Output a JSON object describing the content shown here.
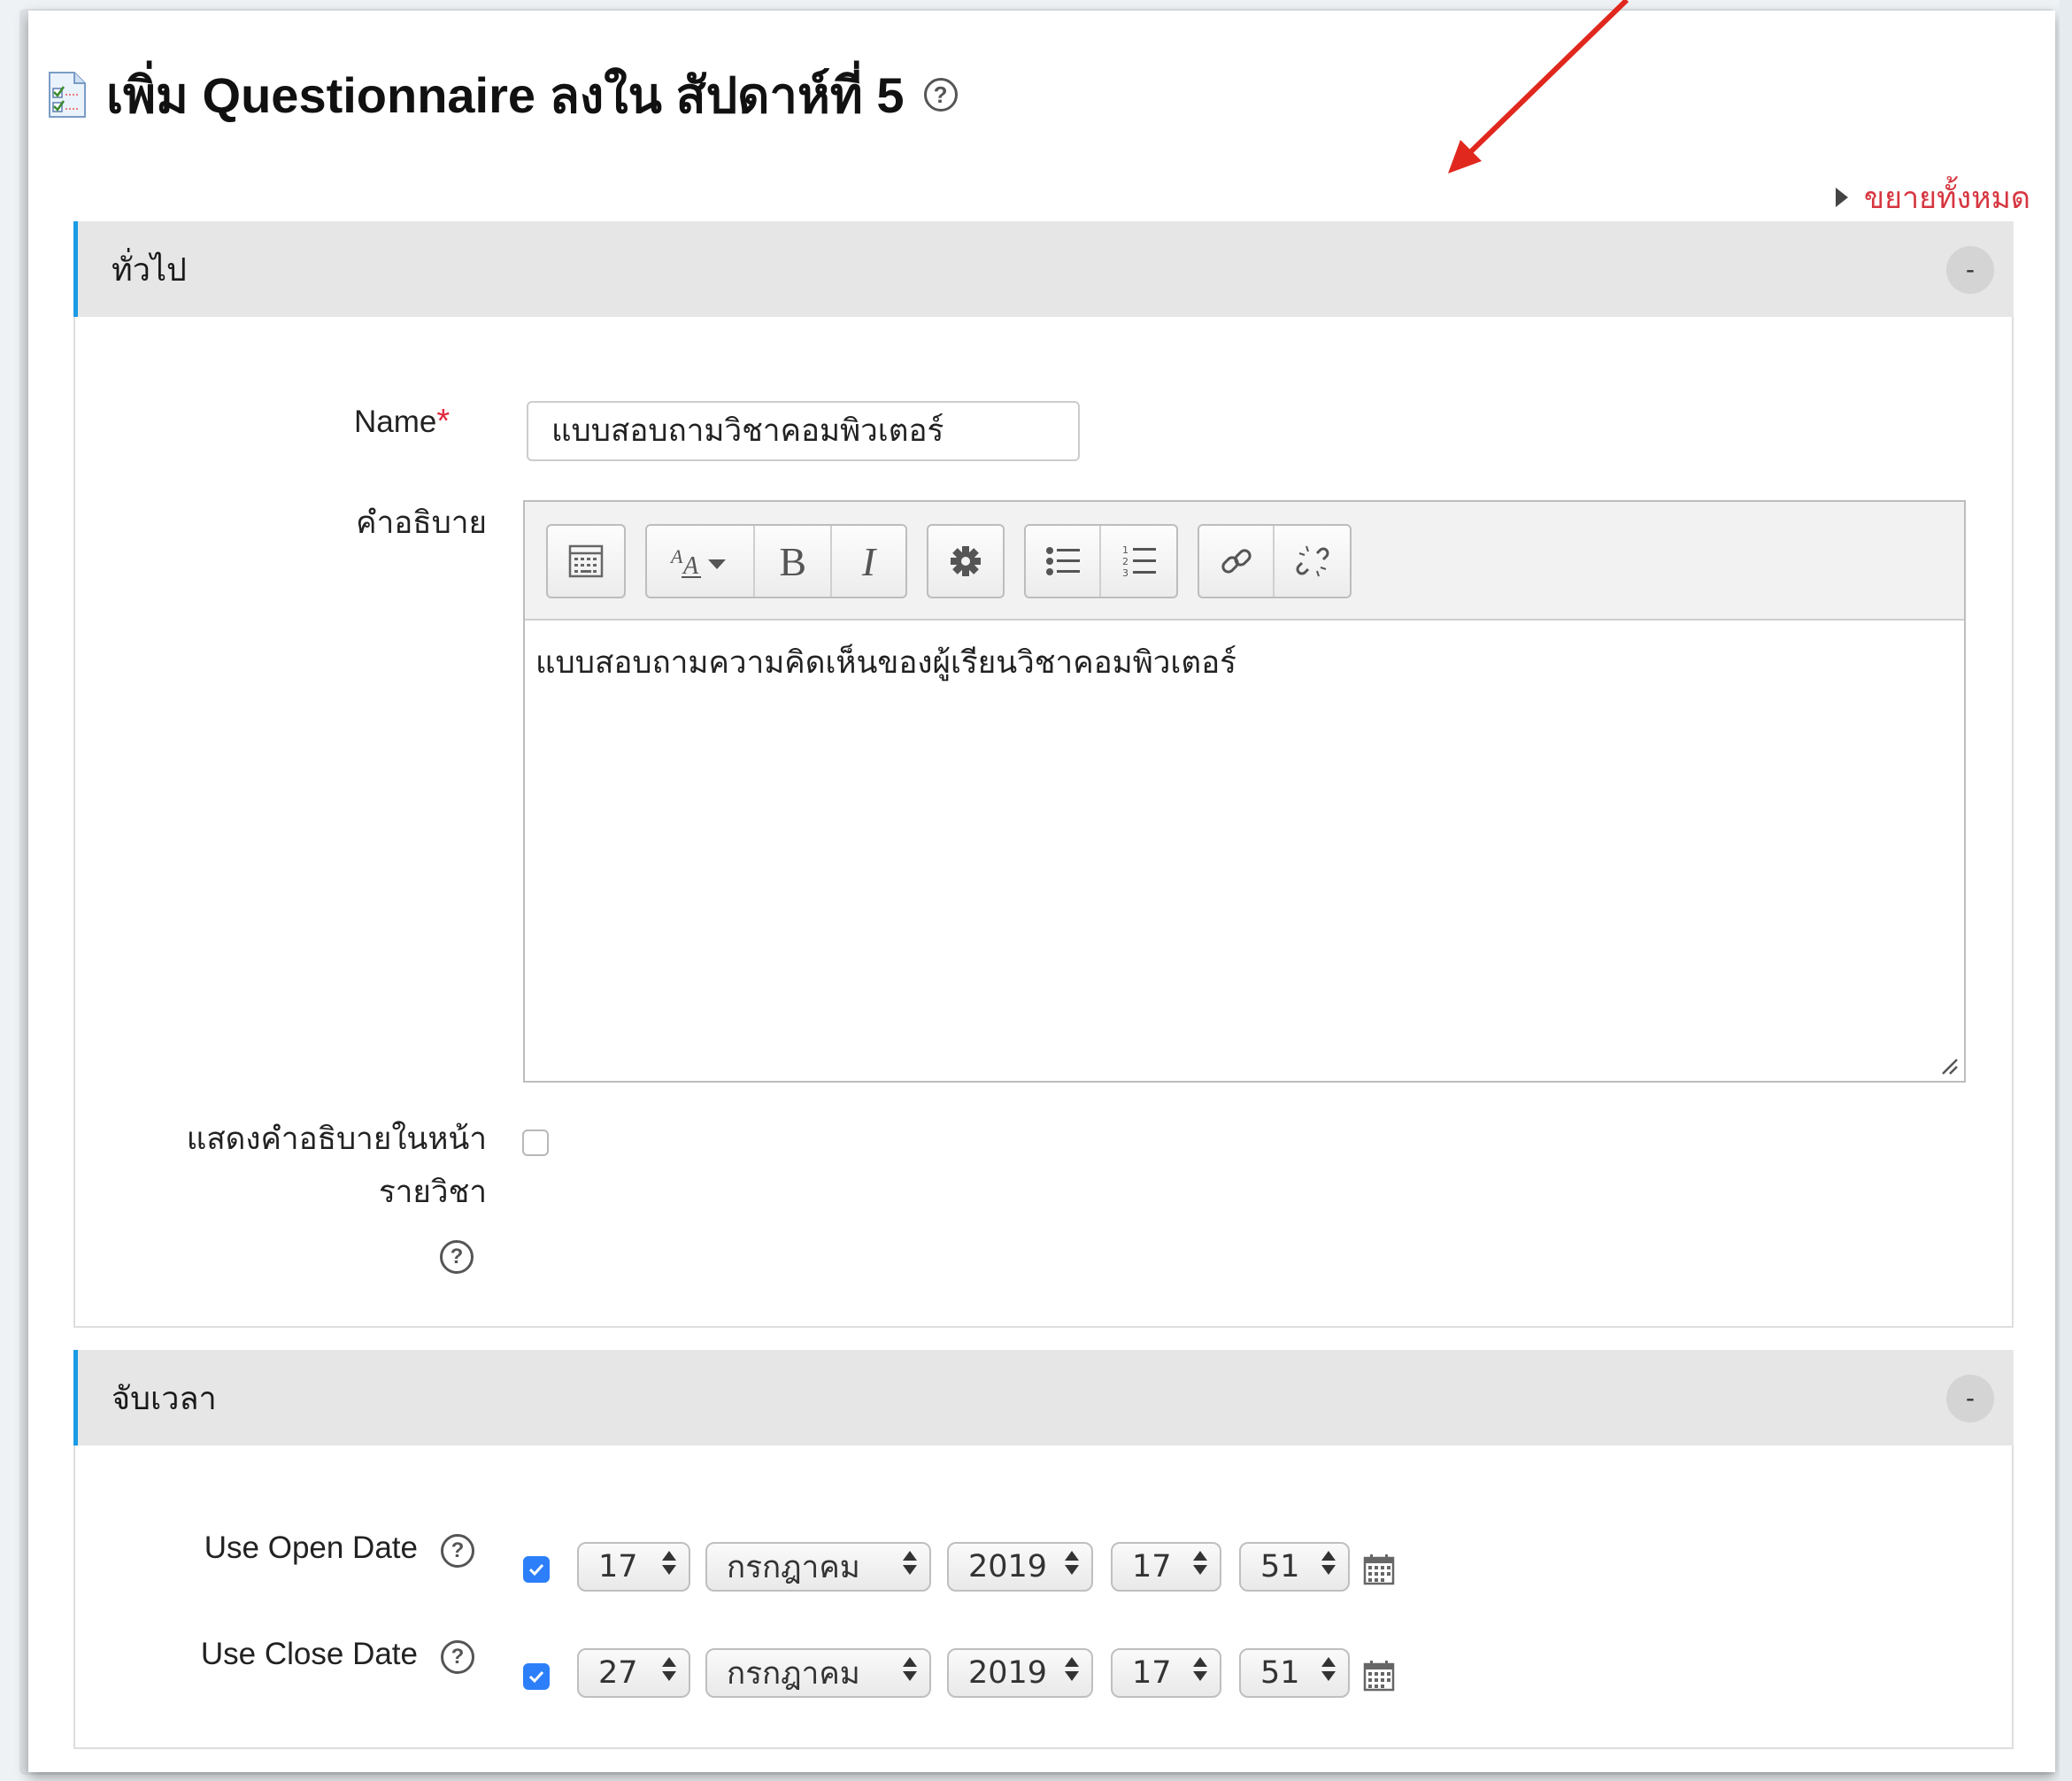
{
  "header": {
    "title": "เพิ่ม Questionnaire ลงใน สัปดาห์ที่ 5",
    "help_glyph": "?",
    "expand_all": "ขยายทั้งหมด"
  },
  "sections": {
    "general": {
      "legend": "ทั่วไป",
      "collapse": "-",
      "name_label": "Name",
      "required_mark": "*",
      "name_value": "แบบสอบถามวิชาคอมพิวเตอร์",
      "description_label": "คำอธิบาย",
      "description_text": "แบบสอบถามความคิดเห็นของผู้เรียนวิชาคอมพิวเตอร์",
      "show_description_line1": "แสดงคำอธิบายในหน้า",
      "show_description_line2": "รายวิชา",
      "show_description_checked": false
    },
    "timing": {
      "legend": "จับเวลา",
      "collapse": "-",
      "open_label": "Use Open Date",
      "close_label": "Use Close Date",
      "open": {
        "enabled": true,
        "day": "17",
        "month": "กรกฎาคม",
        "year": "2019",
        "hour": "17",
        "minute": "51"
      },
      "close": {
        "enabled": true,
        "day": "27",
        "month": "กรกฎาคม",
        "year": "2019",
        "hour": "17",
        "minute": "51"
      }
    }
  },
  "toolbar": {
    "buttons": [
      "show-more-icon",
      "text-style-icon",
      "bold-icon",
      "italic-icon",
      "settings-icon",
      "bullet-list-icon",
      "numbered-list-icon",
      "link-icon",
      "unlink-icon"
    ],
    "bold": "B",
    "italic": "I"
  },
  "colors": {
    "accent": "#1a9be6",
    "link_red": "#d63640",
    "required": "#e0283c",
    "checkbox": "#2d7ff9",
    "arrow": "#e0281e"
  }
}
